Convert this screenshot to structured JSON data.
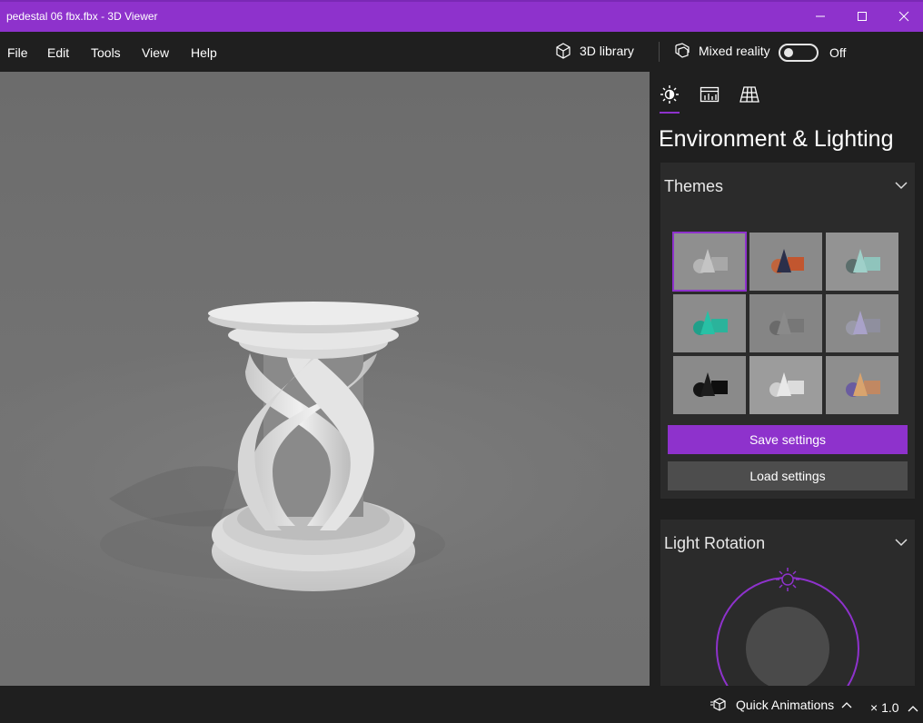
{
  "window": {
    "title": "pedestal 06 fbx.fbx - 3D Viewer",
    "accent": "#8e32cc"
  },
  "menu": {
    "items": [
      "File",
      "Edit",
      "Tools",
      "View",
      "Help"
    ],
    "library_label": "3D library",
    "mixed_reality_label": "Mixed reality",
    "toggle_state": "Off"
  },
  "panel": {
    "tabs": [
      "lighting-icon",
      "stats-icon",
      "grid-icon"
    ],
    "title": "Environment & Lighting",
    "themes_title": "Themes",
    "themes": [
      {
        "name": "theme-1",
        "selected": true
      },
      {
        "name": "theme-2",
        "selected": false
      },
      {
        "name": "theme-3",
        "selected": false
      },
      {
        "name": "theme-4",
        "selected": false
      },
      {
        "name": "theme-5",
        "selected": false
      },
      {
        "name": "theme-6",
        "selected": false
      },
      {
        "name": "theme-7",
        "selected": false
      },
      {
        "name": "theme-8",
        "selected": false
      },
      {
        "name": "theme-9",
        "selected": false
      }
    ],
    "save_label": "Save settings",
    "load_label": "Load settings",
    "light_rotation_title": "Light Rotation"
  },
  "status": {
    "quick_animations_label": "Quick Animations",
    "speed_label": "× 1.0"
  }
}
